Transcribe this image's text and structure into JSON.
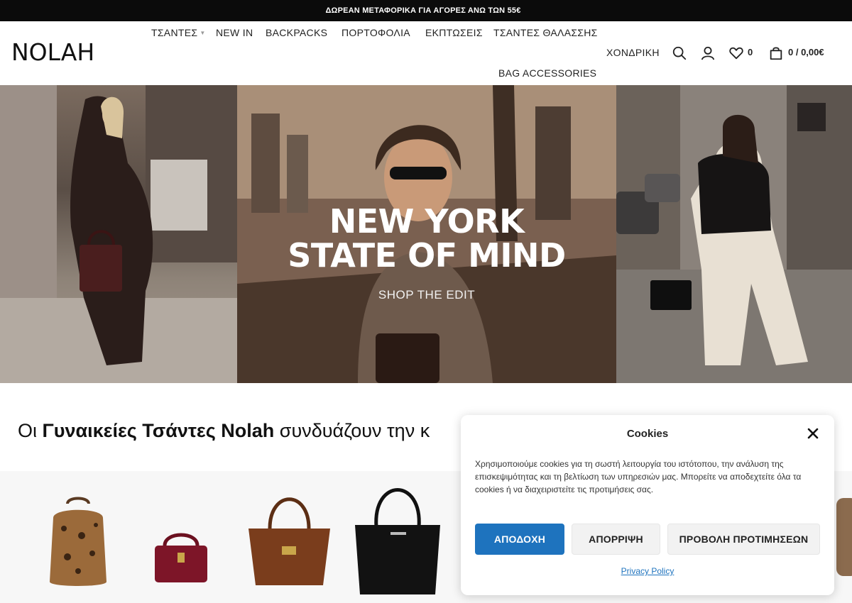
{
  "announcement": "ΔΩΡΕΑΝ ΜΕΤΑΦΟΡΙΚΑ ΓΙΑ ΑΓΟΡΕΣ ΑΝΩ ΤΩΝ 55€",
  "logo": "NOLAH",
  "nav": {
    "items": [
      "ΤΣΑΝΤΕΣ",
      "NEW IN",
      "BACKPACKS",
      "ΠΟΡΤΟΦΟΛΙΑ",
      "ΕΚΠΤΩΣΕΙΣ",
      "ΤΣΑΝΤΕΣ ΘΑΛΑΣΣΗΣ",
      "BAG ACCESSORIES"
    ]
  },
  "header": {
    "wholesale": "ΧΟΝΔΡΙΚΗ",
    "wishlist_count": "0",
    "cart_summary": "0 / 0,00€"
  },
  "hero": {
    "title_line1": "NEW YORK",
    "title_line2": "STATE OF MIND",
    "cta": "SHOP THE EDIT"
  },
  "section": {
    "headline_pre": "Οι ",
    "headline_bold": "Γυναικείες Τσάντες Nolah",
    "headline_post": " συνδυάζουν την κ"
  },
  "cookie": {
    "title": "Cookies",
    "text": "Χρησιμοποιούμε cookies για τη σωστή λειτουργία του ιστότοπου, την ανάλυση της επισκεψιμότητας και τη βελτίωση των υπηρεσιών μας. Μπορείτε να αποδεχτείτε όλα τα cookies ή να διαχειριστείτε τις προτιμήσεις σας.",
    "accept": "ΑΠΟΔΟΧΗ",
    "reject": "ΑΠΟΡΡΙΨΗ",
    "preferences": "ΠΡΟΒΟΛΗ ΠΡΟΤΙΜΗΣΕΩΝ",
    "privacy": "Privacy Policy"
  },
  "colors": {
    "accent": "#1e73be",
    "topbar": "#0b0b0b"
  },
  "icons": [
    "search-icon",
    "user-icon",
    "heart-icon",
    "bag-icon",
    "close-icon",
    "chevron-down-icon"
  ]
}
